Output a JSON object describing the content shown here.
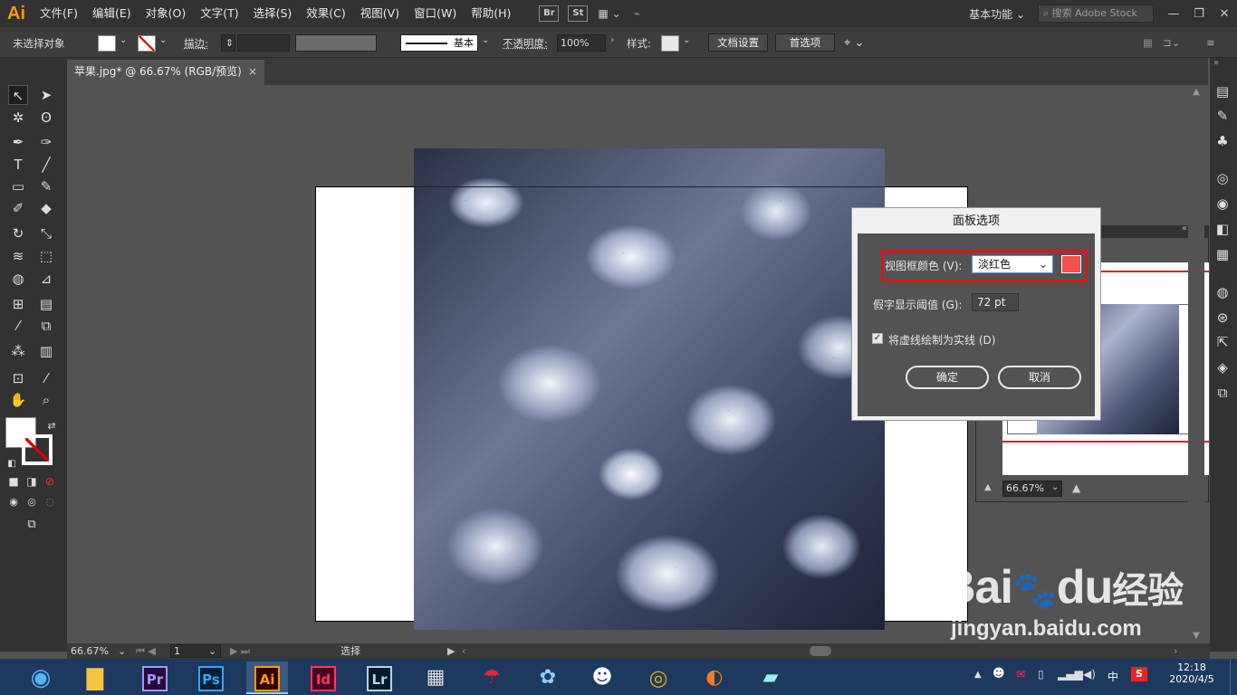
{
  "app": {
    "logo": "Ai"
  },
  "menu": [
    "文件(F)",
    "编辑(E)",
    "对象(O)",
    "文字(T)",
    "选择(S)",
    "效果(C)",
    "视图(V)",
    "窗口(W)",
    "帮助(H)"
  ],
  "bridge_chips": [
    "Br",
    "St"
  ],
  "workspace": "基本功能",
  "stock_search_placeholder": "搜索 Adobe Stock",
  "control": {
    "no_selection": "未选择对象",
    "stroke_label": "描边",
    "stroke_style": "基本",
    "opacity_label": "不透明度",
    "opacity_value": "100%",
    "style_label": "样式",
    "doc_setup": "文档设置",
    "preferences": "首选项"
  },
  "document_tab": {
    "title": "苹果.jpg* @ 66.67% (RGB/预览)",
    "close": "×"
  },
  "dialog": {
    "title": "面板选项",
    "view_box_color_label": "视图框颜色 (V):",
    "view_box_color_value": "淡红色",
    "swatch_color": "#f3504f",
    "threshold_label": "假字显示阈值 (G):",
    "threshold_value": "72 pt",
    "solid_lines_label": "将虚线绘制为实线 (D)",
    "solid_lines_checked": true,
    "ok": "确定",
    "cancel": "取消"
  },
  "navigator": {
    "zoom": "66.67%"
  },
  "status": {
    "zoom": "66.67%",
    "page": "1",
    "mode": "选择"
  },
  "taskbar": {
    "apps": [
      {
        "label": "Pr",
        "color": "#9999ff",
        "bg": "#2a0a3a"
      },
      {
        "label": "Ps",
        "color": "#31a8ff",
        "bg": "#001e36"
      },
      {
        "label": "Ai",
        "color": "#ff9a00",
        "bg": "#330000"
      },
      {
        "label": "Id",
        "color": "#ff3366",
        "bg": "#49021f"
      },
      {
        "label": "Lr",
        "color": "#add5ec",
        "bg": "#001a26"
      }
    ],
    "ime": "中",
    "time": "12:18",
    "date": "2020/4/5"
  },
  "watermark": {
    "brand": "Bai",
    "paw": "du",
    "cn": "经验",
    "url": "jingyan.baidu.com"
  }
}
